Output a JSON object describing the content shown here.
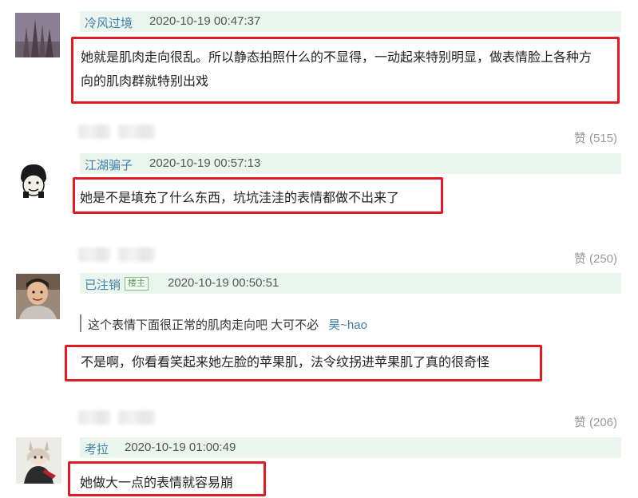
{
  "comments": [
    {
      "username": "冷风过境",
      "timestamp": "2020-10-19 00:47:37",
      "text_line1": "她就是肌肉走向很乱。所以静态拍照什么的不显得，一动起来特别明显，做表情脸上各种方",
      "text_line2": "向的肌肉群就特别出戏",
      "like_label": "赞 (515)"
    },
    {
      "username": "江湖骗子",
      "timestamp": "2020-10-19 00:57:13",
      "text": "她是不是填充了什么东西，坑坑洼洼的表情都做不出来了",
      "like_label": "赞 (250)"
    },
    {
      "username": "已注销",
      "badge": "楼主",
      "timestamp": "2020-10-19 00:50:51",
      "quote_text": "这个表情下面很正常的肌肉走向吧 大可不必",
      "quote_author": "昊~hao",
      "text": "不是啊，你看看笑起来她左脸的苹果肌，法令纹拐进苹果肌了真的很奇怪",
      "like_label": "赞 (206)"
    },
    {
      "username": "考拉",
      "timestamp": "2020-10-19 01:00:49",
      "text": "她做大一点的表情就容易崩"
    }
  ],
  "colors": {
    "highlight_border": "#e11b22",
    "username": "#3f7ea8",
    "header_bg": "#eaf5ee"
  },
  "icons": [
    "avatar-cathedral",
    "avatar-cartoon",
    "avatar-man",
    "avatar-doll"
  ]
}
